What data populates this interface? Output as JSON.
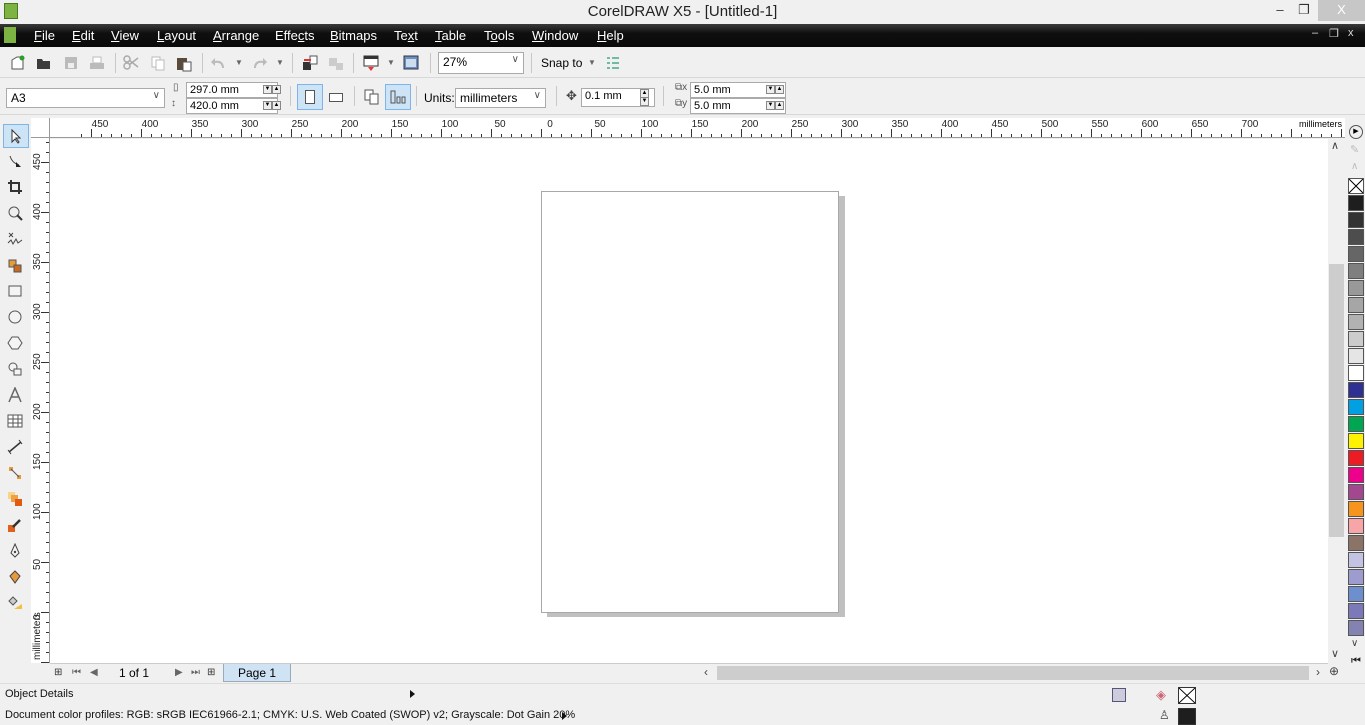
{
  "window": {
    "title": "CorelDRAW X5 - [Untitled-1]",
    "minimize": "–",
    "maximize": "❐",
    "close": "X"
  },
  "menu": {
    "items": [
      {
        "label": "File",
        "u": "F",
        "rest": "ile"
      },
      {
        "label": "Edit",
        "u": "E",
        "rest": "dit"
      },
      {
        "label": "View",
        "u": "V",
        "rest": "iew"
      },
      {
        "label": "Layout",
        "u": "L",
        "rest": "ayout"
      },
      {
        "label": "Arrange",
        "u": "A",
        "rest": "rrange"
      },
      {
        "label": "Effects",
        "pre": "Effe",
        "u": "c",
        "rest": "ts"
      },
      {
        "label": "Bitmaps",
        "u": "B",
        "rest": "itmaps"
      },
      {
        "label": "Text",
        "pre": "Te",
        "u": "x",
        "rest": "t"
      },
      {
        "label": "Table",
        "u": "T",
        "rest": "able"
      },
      {
        "label": "Tools",
        "pre": "T",
        "u": "o",
        "rest": "ols"
      },
      {
        "label": "Window",
        "u": "W",
        "rest": "indow"
      },
      {
        "label": "Help",
        "u": "H",
        "rest": "elp"
      }
    ],
    "doc_minimize": "–",
    "doc_restore": "❐",
    "doc_close": "x"
  },
  "standard_toolbar": {
    "zoom_level": "27%",
    "snap_to_label": "Snap to"
  },
  "property_bar": {
    "page_size": "A3",
    "page_width": "297.0 mm",
    "page_height": "420.0 mm",
    "units_label": "Units:",
    "units_value": "millimeters",
    "nudge": "0.1 mm",
    "dup_x": "5.0 mm",
    "dup_y": "5.0 mm",
    "orientation": "portrait"
  },
  "toolbox": {
    "tools": [
      "pick-tool",
      "shape-tool",
      "crop-tool",
      "zoom-tool",
      "freehand-tool",
      "smart-fill-tool",
      "rectangle-tool",
      "ellipse-tool",
      "polygon-tool",
      "basic-shapes-tool",
      "text-tool",
      "table-tool",
      "dimension-tool",
      "connector-tool",
      "blend-tool",
      "eyedropper-tool",
      "outline-tool",
      "fill-tool",
      "interactive-fill-tool"
    ],
    "active": "pick-tool"
  },
  "rulers": {
    "unit_label": "millimeters",
    "horizontal_labels": [
      "450",
      "400",
      "350",
      "300",
      "250",
      "200",
      "150",
      "100",
      "50",
      "0",
      "50",
      "100",
      "150",
      "200",
      "250",
      "300",
      "350",
      "400",
      "450",
      "500",
      "550",
      "600",
      "650",
      "700"
    ],
    "vertical_labels": [
      "450",
      "400",
      "350",
      "300",
      "250",
      "200",
      "150",
      "100",
      "50",
      "0"
    ]
  },
  "palette": {
    "colors": [
      "#1e1e1e",
      "#333333",
      "#4d4d4d",
      "#666666",
      "#7f7f7f",
      "#999999",
      "#a6a6a6",
      "#b2b2b2",
      "#cccccc",
      "#e5e5e5",
      "#ffffff",
      "#2e3192",
      "#00a0e3",
      "#00a651",
      "#fff200",
      "#ed1c24",
      "#ec008c",
      "#a3478f",
      "#f7941d",
      "#f8a5a8",
      "#8b7367",
      "#c5c3e3",
      "#9e9bcf",
      "#6d8fce",
      "#7b79b8",
      "#8482b0"
    ]
  },
  "page_navigator": {
    "page_count_text": "1 of 1",
    "page_tab": "Page 1"
  },
  "status": {
    "object_details": "Object Details",
    "color_profiles": "Document color profiles: RGB: sRGB IEC61966-2.1; CMYK: U.S. Web Coated (SWOP) v2; Grayscale: Dot Gain 20%",
    "fill_color": "none",
    "outline_color": "#1e1e1e"
  }
}
